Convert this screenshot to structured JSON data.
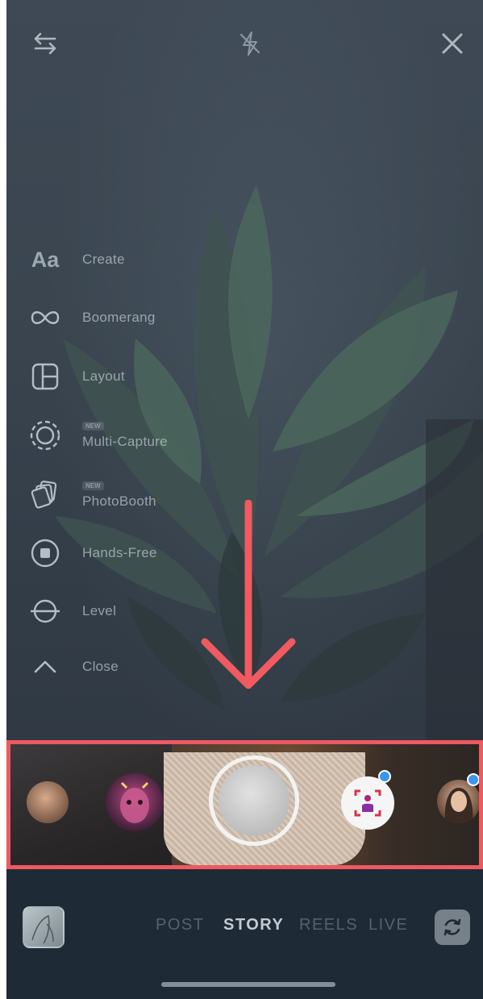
{
  "top_bar": {
    "left_icon": "arrows-swap-icon",
    "center_icon": "flash-off-icon",
    "right_icon": "close-icon"
  },
  "tools": [
    {
      "label": "Create",
      "badge": "",
      "icon": "text-aa-icon"
    },
    {
      "label": "Boomerang",
      "badge": "",
      "icon": "infinity-icon"
    },
    {
      "label": "Layout",
      "badge": "",
      "icon": "layout-grid-icon"
    },
    {
      "label": "Multi-Capture",
      "badge": "NEW",
      "icon": "multi-capture-icon"
    },
    {
      "label": "PhotoBooth",
      "badge": "NEW",
      "icon": "photobooth-icon"
    },
    {
      "label": "Hands-Free",
      "badge": "",
      "icon": "hands-free-icon"
    },
    {
      "label": "Level",
      "badge": "",
      "icon": "level-icon"
    },
    {
      "label": "Close",
      "badge": "",
      "icon": "chevron-up-icon"
    }
  ],
  "aa_glyph": "Aa",
  "capture_modes": [
    "POST",
    "STORY",
    "REELS",
    "LIVE"
  ],
  "active_mode": "STORY",
  "colors": {
    "highlight_border": "#ee5962",
    "arrow": "#f05a60",
    "new_dot": "#3897f0"
  }
}
